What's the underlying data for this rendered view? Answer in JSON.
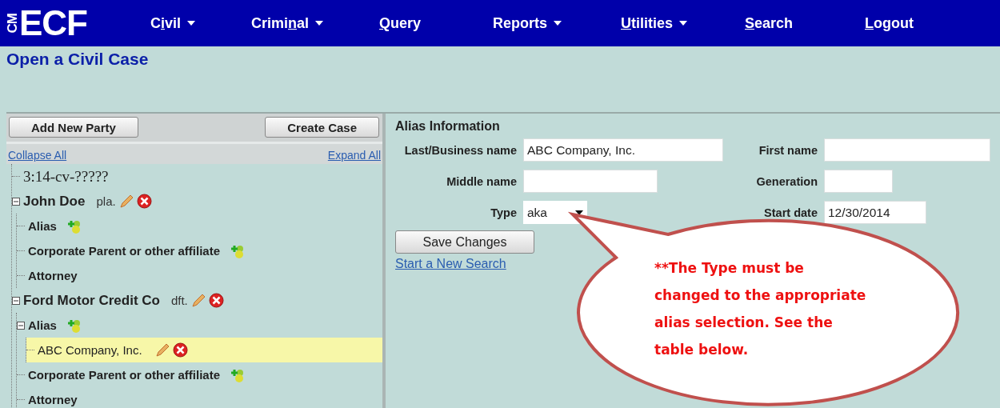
{
  "logo": {
    "side": "CM",
    "main": "ECF"
  },
  "menu": [
    {
      "before": "C",
      "key": "i",
      "after": "vil",
      "has_menu": true
    },
    {
      "before": "Crimi",
      "key": "n",
      "after": "al",
      "has_menu": true
    },
    {
      "key": "Q",
      "after": "uery",
      "has_menu": false
    },
    {
      "before": "Reports",
      "has_menu": true
    },
    {
      "key": "U",
      "after": "tilities",
      "has_menu": true
    },
    {
      "key": "S",
      "after": "earch",
      "has_menu": false
    },
    {
      "key": "L",
      "after": "ogout",
      "has_menu": false
    }
  ],
  "page_title": "Open a Civil Case",
  "left_panel": {
    "buttons": [
      "Add New Party",
      "Create Case"
    ],
    "collapse_link": "Collapse All",
    "expand_link": "Expand All",
    "tree": [
      {
        "label": "3:14-cv-?????",
        "kind": "case"
      },
      {
        "label": "John Doe",
        "role": "pla.",
        "kind": "party",
        "expanded": true,
        "children": [
          {
            "label": "Alias",
            "kind": "group",
            "can_add": true
          },
          {
            "label": "Corporate Parent or other affiliate",
            "kind": "group",
            "can_add": true
          },
          {
            "label": "Attorney",
            "kind": "group",
            "can_add": false
          }
        ]
      },
      {
        "label": "Ford Motor Credit Co",
        "role": "dft.",
        "kind": "party",
        "expanded": true,
        "children": [
          {
            "label": "Alias",
            "kind": "group",
            "can_add": true,
            "expanded": true,
            "children": [
              {
                "label": "ABC Company, Inc.",
                "kind": "alias",
                "selected": true
              }
            ]
          },
          {
            "label": "Corporate Parent or other affiliate",
            "kind": "group",
            "can_add": true
          },
          {
            "label": "Attorney",
            "kind": "group",
            "can_add": false
          }
        ]
      }
    ]
  },
  "alias_form": {
    "heading": "Alias Information",
    "fields": [
      {
        "label": "Last/Business name",
        "value": "ABC Company, Inc.",
        "kind": "text"
      },
      {
        "label": "First name",
        "kind": "text"
      },
      {
        "label": "Middle name",
        "kind": "text"
      },
      {
        "label": "Generation",
        "kind": "text"
      },
      {
        "label": "Type",
        "value": "aka",
        "kind": "select"
      },
      {
        "label": "Start date",
        "value": "12/30/2014",
        "kind": "text"
      }
    ],
    "save_button": "Save Changes",
    "new_search_link": "Start a New Search"
  },
  "callout": {
    "lines": [
      "**The Type must be",
      "changed to the appropriate",
      "alias selection. See the",
      "table below."
    ]
  }
}
